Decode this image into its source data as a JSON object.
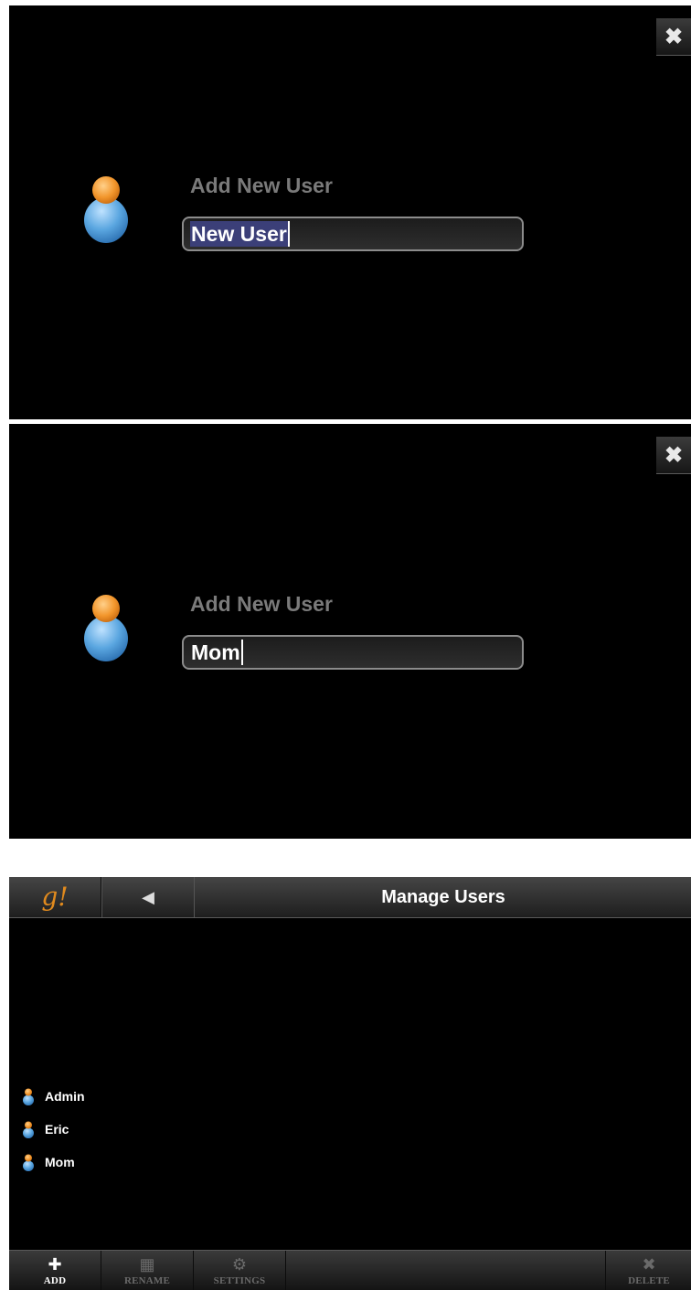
{
  "screens": [
    {
      "close_glyph": "✖",
      "title": "Add New User",
      "input_value": "New User",
      "input_selected": true
    },
    {
      "close_glyph": "✖",
      "title": "Add New User",
      "input_value": "Mom",
      "input_selected": false
    }
  ],
  "manage": {
    "logo": "g!",
    "back_icon": "◀",
    "title": "Manage Users",
    "users": [
      {
        "name": "Admin"
      },
      {
        "name": "Eric"
      },
      {
        "name": "Mom"
      }
    ],
    "toolbar": {
      "add": {
        "icon": "✚",
        "label": "ADD",
        "enabled": true
      },
      "rename": {
        "icon": "▦",
        "label": "RENAME",
        "enabled": false
      },
      "settings": {
        "icon": "⚙",
        "label": "SETTINGS",
        "enabled": false
      },
      "delete": {
        "icon": "✖",
        "label": "DELETE",
        "enabled": false
      }
    }
  },
  "colors": {
    "accent_orange": "#e08a1e",
    "icon_blue": "#5aa6e0",
    "selection": "#3b3f78",
    "title_gray": "#7a7a7a"
  }
}
